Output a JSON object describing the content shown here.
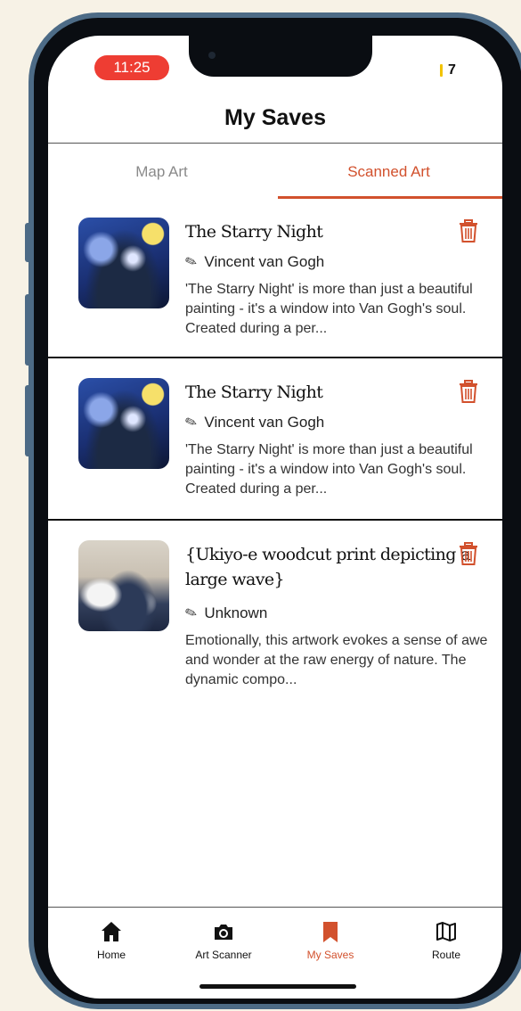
{
  "status_bar": {
    "time": "11:25",
    "battery": "7"
  },
  "header": {
    "title": "My Saves"
  },
  "tabs": [
    {
      "label": "Map Art",
      "active": false
    },
    {
      "label": "Scanned Art",
      "active": true
    }
  ],
  "saves": [
    {
      "title": "The Starry Night",
      "artist": "Vincent van Gogh",
      "description": "'The Starry Night' is more than just a beautiful painting - it's a window into Van Gogh's soul. Created during a per..."
    },
    {
      "title": "The Starry Night",
      "artist": "Vincent van Gogh",
      "description": "'The Starry Night' is more than just a beautiful painting - it's a window into Van Gogh's soul. Created during a per..."
    },
    {
      "title": "{Ukiyo-e woodcut print depicting a large wave}",
      "artist": "Unknown",
      "description": "Emotionally, this artwork evokes a sense of awe and wonder at the raw energy of nature. The dynamic compo..."
    }
  ],
  "bottom_nav": [
    {
      "label": "Home",
      "icon": "home-icon",
      "active": false
    },
    {
      "label": "Art Scanner",
      "icon": "camera-icon",
      "active": false
    },
    {
      "label": "My Saves",
      "icon": "bookmark-icon",
      "active": true
    },
    {
      "label": "Route",
      "icon": "map-icon",
      "active": false
    }
  ],
  "colors": {
    "accent": "#d2512d",
    "time_pill": "#ee3d33",
    "background": "#f7f2e6",
    "frame": "#4d6b86"
  }
}
